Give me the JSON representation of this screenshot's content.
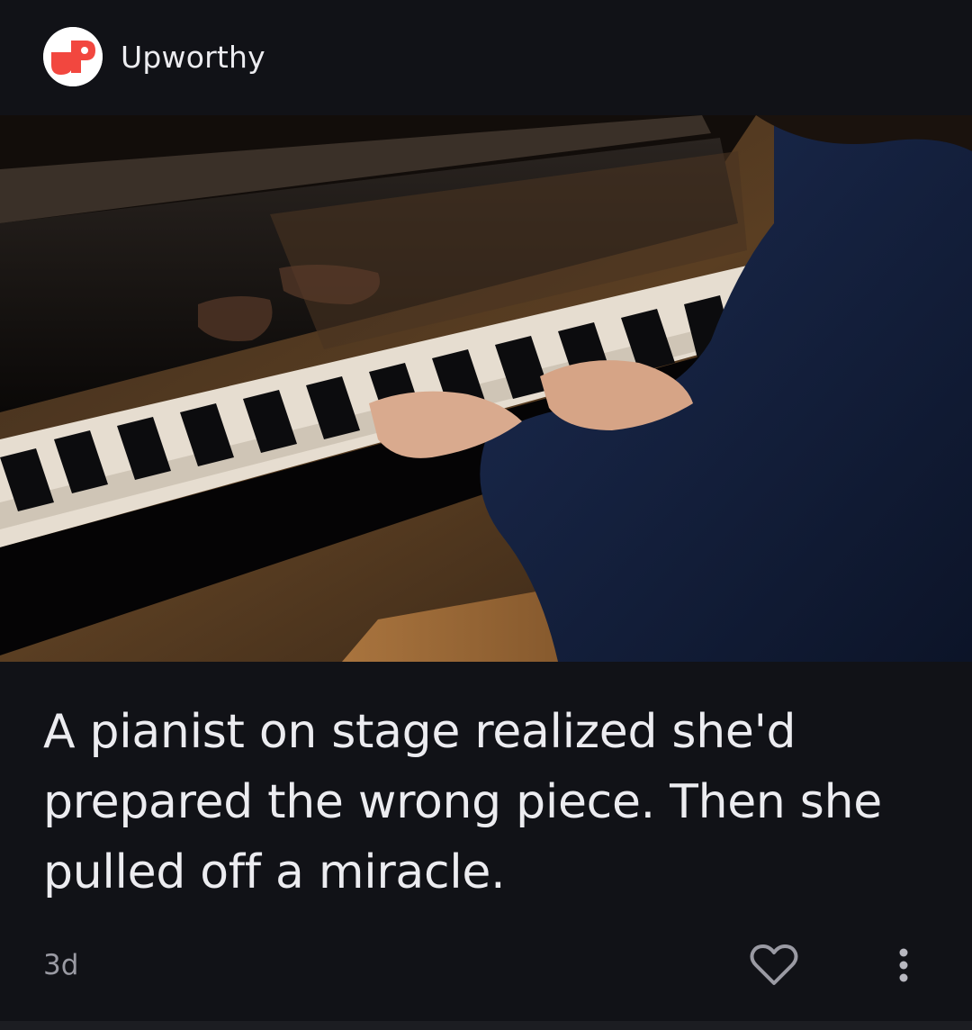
{
  "card": {
    "source": {
      "name": "Upworthy",
      "logo_icon": "upworthy-logo-icon",
      "logo_color": "#f2473f"
    },
    "image": {
      "icon": "pianist-photo"
    },
    "headline": "A pianist on stage realized she'd prepared the wrong piece. Then she pulled off a miracle.",
    "age": "3d",
    "actions": {
      "like_icon": "heart-outline-icon",
      "more_icon": "more-vert-icon"
    }
  },
  "theme": {
    "background": "#111217",
    "text": "#ececf0",
    "muted": "#9a9aa3"
  }
}
